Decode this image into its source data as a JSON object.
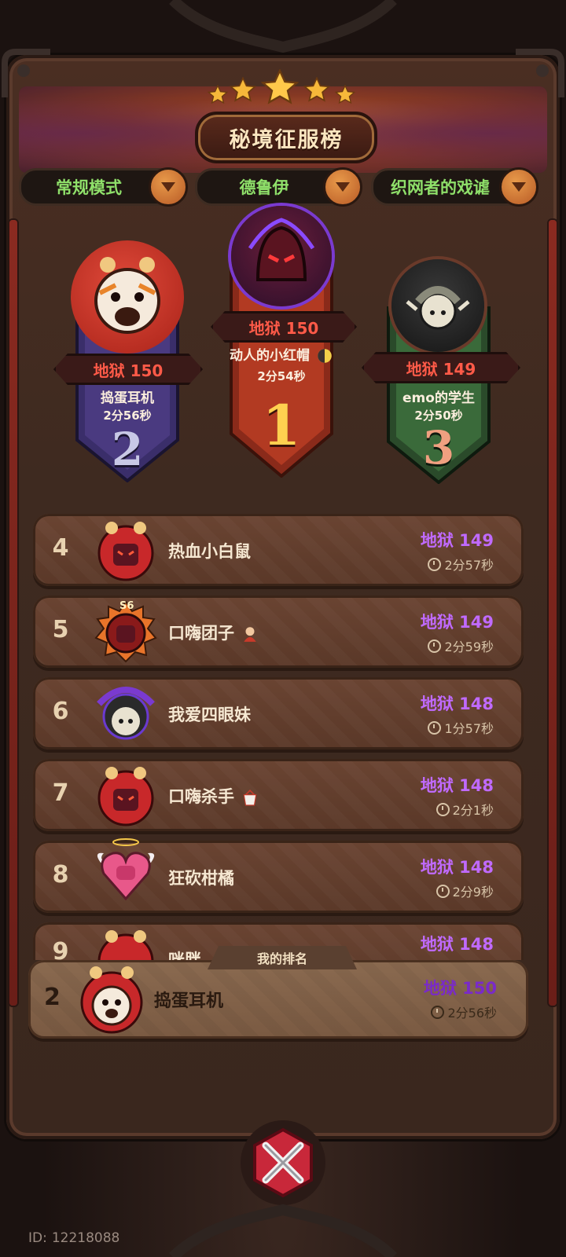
{
  "title": "秘境征服榜",
  "filters": [
    {
      "label": "常规模式"
    },
    {
      "label": "德鲁伊"
    },
    {
      "label": "织网者的戏谑"
    }
  ],
  "podium": [
    {
      "place": "2",
      "difficulty": "地狱 150",
      "name": "捣蛋耳机",
      "time": "2分56秒"
    },
    {
      "place": "1",
      "difficulty": "地狱 150",
      "name": "动人的小红帽",
      "time": "2分54秒"
    },
    {
      "place": "3",
      "difficulty": "地狱 149",
      "name": "emo的学生",
      "time": "2分50秒"
    }
  ],
  "rows": [
    {
      "rank": "4",
      "name": "热血小白鼠",
      "difficulty": "地狱 149",
      "time": "2分57秒"
    },
    {
      "rank": "5",
      "name": "口嗨团子",
      "difficulty": "地狱 149",
      "time": "2分59秒"
    },
    {
      "rank": "6",
      "name": "我爱四眼妹",
      "difficulty": "地狱 148",
      "time": "1分57秒"
    },
    {
      "rank": "7",
      "name": "口嗨杀手",
      "difficulty": "地狱 148",
      "time": "2分1秒"
    },
    {
      "rank": "8",
      "name": "狂砍柑橘",
      "difficulty": "地狱 148",
      "time": "2分9秒"
    }
  ],
  "peek_row": {
    "rank": "9",
    "name": "咪胖",
    "difficulty": "地狱 148"
  },
  "avatar_badge_5": "S6",
  "my_rank": {
    "tag": "我的排名",
    "rank": "2",
    "name": "捣蛋耳机",
    "difficulty": "地狱 150",
    "time": "2分56秒"
  },
  "footer": {
    "id_label": "ID:",
    "id_value": "12218088"
  },
  "colors": {
    "accent_green": "#8fe06a",
    "difficulty_purple": "#c06aff",
    "difficulty_red": "#ff5a48"
  }
}
